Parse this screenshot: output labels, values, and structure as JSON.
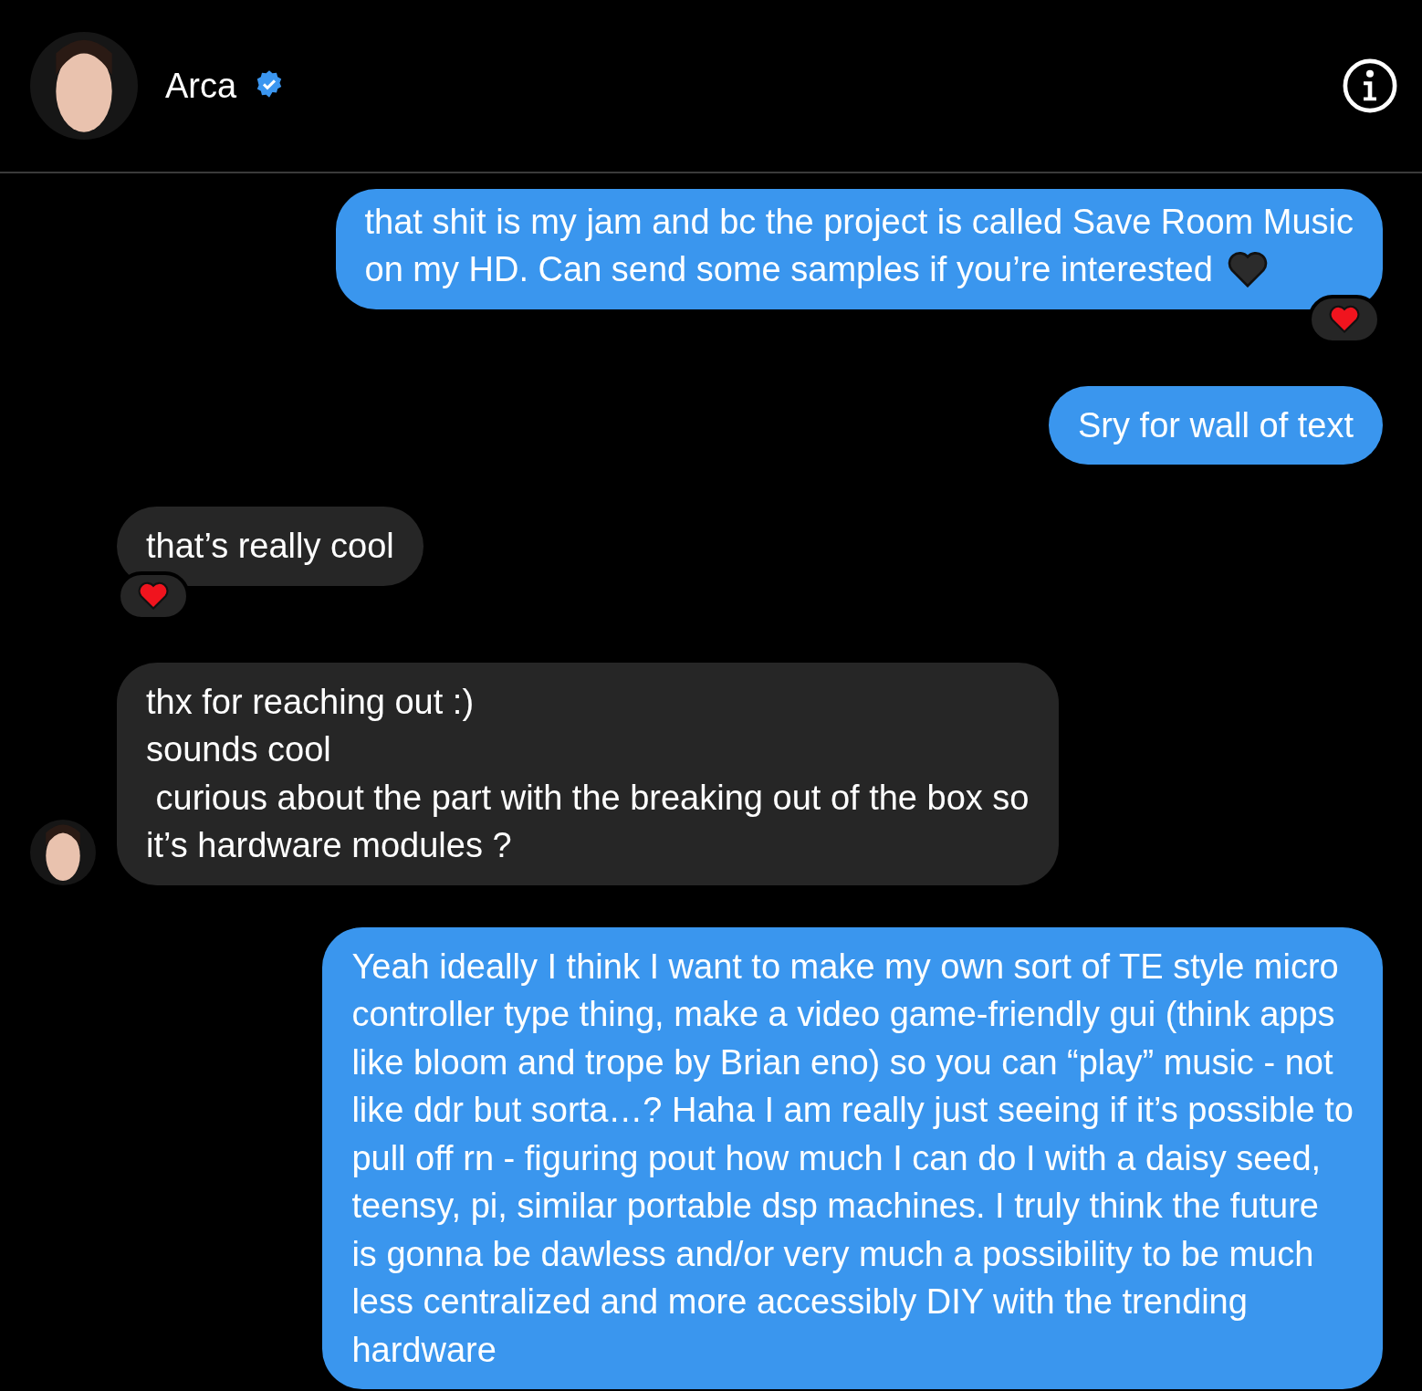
{
  "header": {
    "name": "Arca",
    "verified": true
  },
  "messages": [
    {
      "kind": "outgoing",
      "cut_top": true,
      "lines": [
        "that shit is my jam and bc the project is called Save Room Music",
        "on my HD. Can send some samples if you’re interested"
      ],
      "has_heart": true,
      "reacted": true,
      "show_avatar": false
    },
    {
      "kind": "outgoing",
      "cut_top": false,
      "lines": [
        "Sry for wall of text"
      ],
      "has_heart": false,
      "reacted": false,
      "show_avatar": false
    },
    {
      "kind": "incoming",
      "cut_top": false,
      "lines": [
        "that’s really cool"
      ],
      "has_heart": false,
      "reacted": true,
      "show_avatar": false
    },
    {
      "kind": "incoming",
      "cut_top": false,
      "lines": [
        "thx for reaching out :)",
        "sounds cool",
        " curious about the part with the breaking out of the box so",
        "it’s hardware modules ?"
      ],
      "has_heart": false,
      "reacted": false,
      "show_avatar": true
    },
    {
      "kind": "outgoing",
      "cut_top": false,
      "lines": [
        "Yeah ideally I think I want to make my own sort of TE style micro",
        "controller type thing, make a video game-friendly gui (think apps",
        "like bloom and trope by Brian eno) so you can “play” music - not",
        "like ddr but sorta…? Haha I am really just seeing if it’s possible to",
        "pull off rn - figuring pout how much I can do I with a daisy seed,",
        "teensy, pi, similar portable dsp machines. I truly think the future",
        "is gonna be dawless and/or very much a possibility to be much",
        "less centralized and more accessibly DIY with the trending",
        "hardware"
      ],
      "has_heart": false,
      "reacted": false,
      "show_avatar": false
    }
  ]
}
